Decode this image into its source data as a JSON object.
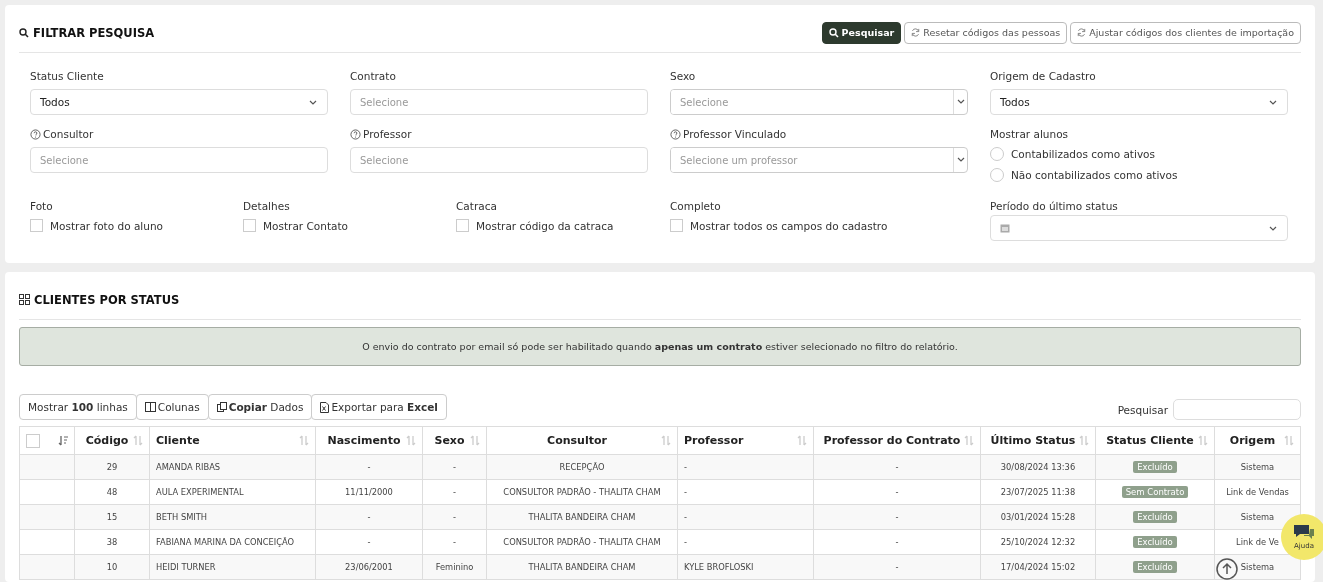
{
  "filter_panel": {
    "title": "FILTRAR PESQUISA",
    "buttons": [
      {
        "label": "Pesquisar",
        "kind": "primary"
      },
      {
        "label": "Resetar códigos das pessoas",
        "kind": "refresh"
      },
      {
        "label": "Ajustar códigos dos clientes de importação",
        "kind": "refresh"
      }
    ],
    "fields": [
      {
        "label": "Status Cliente",
        "kind": "select",
        "value": "Todos",
        "help": false
      },
      {
        "label": "Contrato",
        "kind": "input",
        "placeholder": "Selecione",
        "help": false
      },
      {
        "label": "Sexo",
        "kind": "combo",
        "placeholder": "Selecione",
        "help": false
      },
      {
        "label": "Origem de Cadastro",
        "kind": "select",
        "value": "Todos",
        "help": false
      },
      {
        "label": "Consultor",
        "kind": "input",
        "placeholder": "Selecione",
        "help": true
      },
      {
        "label": "Professor",
        "kind": "input",
        "placeholder": "Selecione",
        "help": true
      },
      {
        "label": "Professor Vinculado",
        "kind": "combo",
        "placeholder": "Selecione um professor",
        "help": true
      },
      {
        "label": "Mostrar alunos",
        "kind": "radios",
        "options": [
          {
            "label": "Contabilizados como ativos",
            "selected": false
          },
          {
            "label": "Não contabilizados como ativos",
            "selected": false
          }
        ]
      }
    ],
    "checks": [
      {
        "group": "Foto",
        "label": "Mostrar foto do aluno",
        "checked": false
      },
      {
        "group": "Detalhes",
        "label": "Mostrar Contato",
        "checked": false
      },
      {
        "group": "Catraca",
        "label": "Mostrar código da catraca",
        "checked": false
      },
      {
        "group": "Completo",
        "label": "Mostrar todos os campos do cadastro",
        "checked": false
      }
    ],
    "period": {
      "label": "Período do último status"
    }
  },
  "status_panel": {
    "title": "CLIENTES POR STATUS",
    "notice": "O envio do contrato por email só pode ser habilitado quando **apenas um contrato** estiver selecionado no filtro do relatório.",
    "toolbar": [
      "Mostrar **100** linhas",
      "Colunas",
      "**Copiar** Dados",
      "Exportar para **Excel**"
    ],
    "search_label": "Pesquisar",
    "table": {
      "select_all": false,
      "columns": [
        "Código",
        "Cliente",
        "Nascimento",
        "Sexo",
        "Consultor",
        "Professor",
        "Professor do Contrato",
        "Último Status",
        "Status Cliente",
        "Origem"
      ],
      "rows": [
        {
          "cells": [
            "29",
            "AMANDA RIBAS",
            "-",
            "-",
            "RECEPÇÃO",
            "-",
            "-",
            "30/08/2024 13:36",
            "Excluído",
            "Sistema"
          ]
        },
        {
          "cells": [
            "48",
            "AULA EXPERIMENTAL",
            "11/11/2000",
            "-",
            "CONSULTOR PADRÃO - THALITA CHAM",
            "-",
            "-",
            "23/07/2025 11:38",
            "Sem Contrato",
            "Link de Vendas"
          ]
        },
        {
          "cells": [
            "15",
            "BETH SMITH",
            "-",
            "-",
            "THALITA BANDEIRA CHAM",
            "-",
            "-",
            "03/01/2024 15:28",
            "Excluído",
            "Sistema"
          ]
        },
        {
          "cells": [
            "38",
            "FABIANA MARINA DA CONCEIÇÃO",
            "-",
            "-",
            "CONSULTOR PADRÃO - THALITA CHAM",
            "-",
            "-",
            "25/10/2024 12:32",
            "Excluído",
            "Link de Ve"
          ]
        },
        {
          "cells": [
            "10",
            "HEIDI TURNER",
            "23/06/2001",
            "Feminino",
            "THALITA BANDEIRA CHAM",
            "KYLE BROFLOSKI",
            "-",
            "17/04/2024 15:02",
            "Excluído",
            "Sistema"
          ]
        }
      ]
    }
  },
  "help_bubble": {
    "label": "Ajuda"
  }
}
